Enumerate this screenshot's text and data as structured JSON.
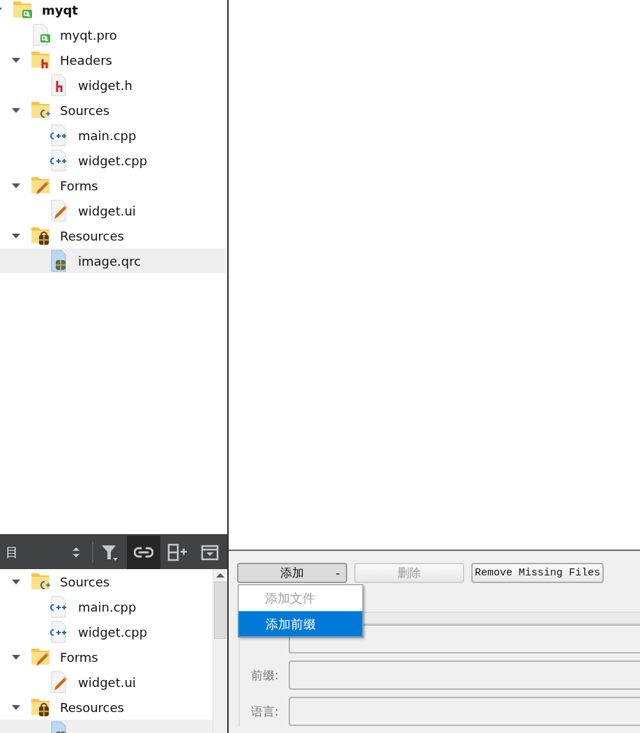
{
  "project_tree": {
    "items": [
      {
        "label": "myqt",
        "kind": "project",
        "expanded": true,
        "selected": false,
        "children": [
          {
            "label": "myqt.pro",
            "kind": "pro",
            "selected": false
          },
          {
            "label": "Headers",
            "kind": "headers",
            "expanded": true,
            "selected": false,
            "children": [
              {
                "label": "widget.h",
                "kind": "header",
                "selected": false
              }
            ]
          },
          {
            "label": "Sources",
            "kind": "sources",
            "expanded": true,
            "selected": false,
            "children": [
              {
                "label": "main.cpp",
                "kind": "source",
                "selected": false
              },
              {
                "label": "widget.cpp",
                "kind": "source",
                "selected": false
              }
            ]
          },
          {
            "label": "Forms",
            "kind": "forms",
            "expanded": true,
            "selected": false,
            "children": [
              {
                "label": "widget.ui",
                "kind": "form",
                "selected": false
              }
            ]
          },
          {
            "label": "Resources",
            "kind": "resources",
            "expanded": true,
            "selected": false,
            "children": [
              {
                "label": "image.qrc",
                "kind": "resource",
                "selected": true
              }
            ]
          }
        ]
      }
    ]
  },
  "projects_toolbar": {
    "title": "目",
    "tools": [
      {
        "kind": "updown"
      },
      {
        "kind": "filter"
      },
      {
        "kind": "link",
        "active": true
      },
      {
        "kind": "split"
      },
      {
        "kind": "close"
      }
    ]
  },
  "bottom_tree": {
    "items": [
      {
        "label": "Sources",
        "kind": "sources",
        "expanded": true,
        "selected": false,
        "children": [
          {
            "label": "main.cpp",
            "kind": "source",
            "selected": false
          },
          {
            "label": "widget.cpp",
            "kind": "source",
            "selected": false
          }
        ]
      },
      {
        "label": "Forms",
        "kind": "forms",
        "expanded": true,
        "selected": false,
        "children": [
          {
            "label": "widget.ui",
            "kind": "form",
            "selected": false
          }
        ]
      },
      {
        "label": "Resources",
        "kind": "resources",
        "expanded": true,
        "selected": false,
        "children": [
          {
            "kind": "resource",
            "selected": true
          }
        ]
      }
    ]
  },
  "resource_editor": {
    "buttons": [
      {
        "label": "添加",
        "kind": "dropdown",
        "pressed": true,
        "disabled": false
      },
      {
        "label": "删除",
        "kind": "plain",
        "pressed": false,
        "disabled": true
      },
      {
        "label": "Remove Missing Files",
        "kind": "plain",
        "pressed": false,
        "disabled": false
      }
    ],
    "add_menu": [
      {
        "label": "添加文件",
        "disabled": true,
        "selected": false
      },
      {
        "label": "添加前缀",
        "disabled": false,
        "selected": true
      }
    ],
    "fields": [
      {
        "kind": "unlabeled"
      },
      {
        "kind": "labeled",
        "label": "前缀:"
      },
      {
        "kind": "labeled",
        "label": "语言:"
      }
    ]
  }
}
